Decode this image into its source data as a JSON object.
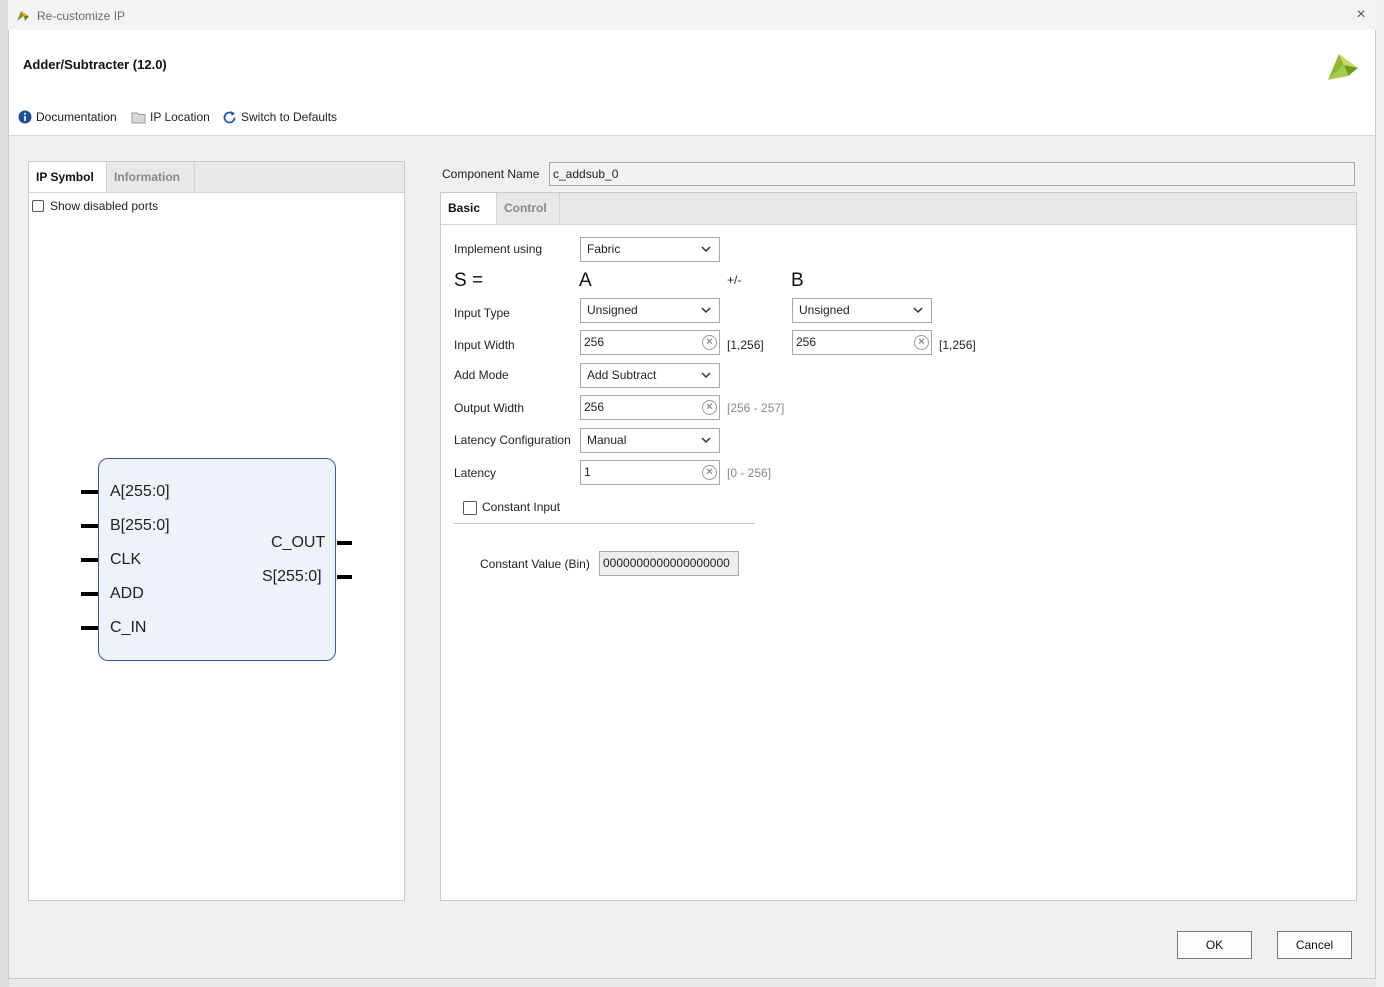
{
  "window": {
    "title": "Re-customize IP",
    "close_glyph": "×"
  },
  "header": {
    "ip_title": "Adder/Subtracter (12.0)"
  },
  "toolbar": {
    "documentation": "Documentation",
    "ip_location": "IP Location",
    "switch_defaults": "Switch to Defaults"
  },
  "left_panel": {
    "tabs": [
      "IP Symbol",
      "Information"
    ],
    "show_disabled_ports": "Show disabled ports",
    "symbol": {
      "inputs": [
        "A[255:0]",
        "B[255:0]",
        "CLK",
        "ADD",
        "C_IN"
      ],
      "outputs": [
        "C_OUT",
        "S[255:0]"
      ]
    }
  },
  "component": {
    "label": "Component Name",
    "value": "c_addsub_0"
  },
  "right_panel": {
    "tabs": [
      "Basic",
      "Control"
    ],
    "implement_using": {
      "label": "Implement using",
      "value": "Fabric"
    },
    "equation": {
      "s": "S =",
      "a": "A",
      "op": "+/-",
      "b": "B"
    },
    "input_type": {
      "label": "Input Type",
      "a_value": "Unsigned",
      "b_value": "Unsigned"
    },
    "input_width": {
      "label": "Input Width",
      "a_value": "256",
      "a_range": "[1,256]",
      "b_value": "256",
      "b_range": "[1,256]"
    },
    "add_mode": {
      "label": "Add Mode",
      "value": "Add Subtract"
    },
    "output_width": {
      "label": "Output Width",
      "value": "256",
      "range": "[256 - 257]"
    },
    "latency_config": {
      "label": "Latency Configuration",
      "value": "Manual"
    },
    "latency": {
      "label": "Latency",
      "value": "1",
      "range": "[0 - 256]"
    },
    "constant_input": {
      "label": "Constant Input",
      "checked": false
    },
    "constant_value": {
      "label": "Constant Value (Bin)",
      "value": "0000000000000000000"
    }
  },
  "buttons": {
    "ok": "OK",
    "cancel": "Cancel"
  },
  "colors": {
    "symbol_border": "#3b5aa5",
    "symbol_fill": "#eef3fa",
    "logo": "#8dbb2b"
  },
  "icons": {
    "info": "info-icon",
    "folder": "folder-icon",
    "refresh": "refresh-icon",
    "chevron": "chevron-down-icon",
    "clear": "clear-icon",
    "logo": "xilinx-logo-icon"
  }
}
